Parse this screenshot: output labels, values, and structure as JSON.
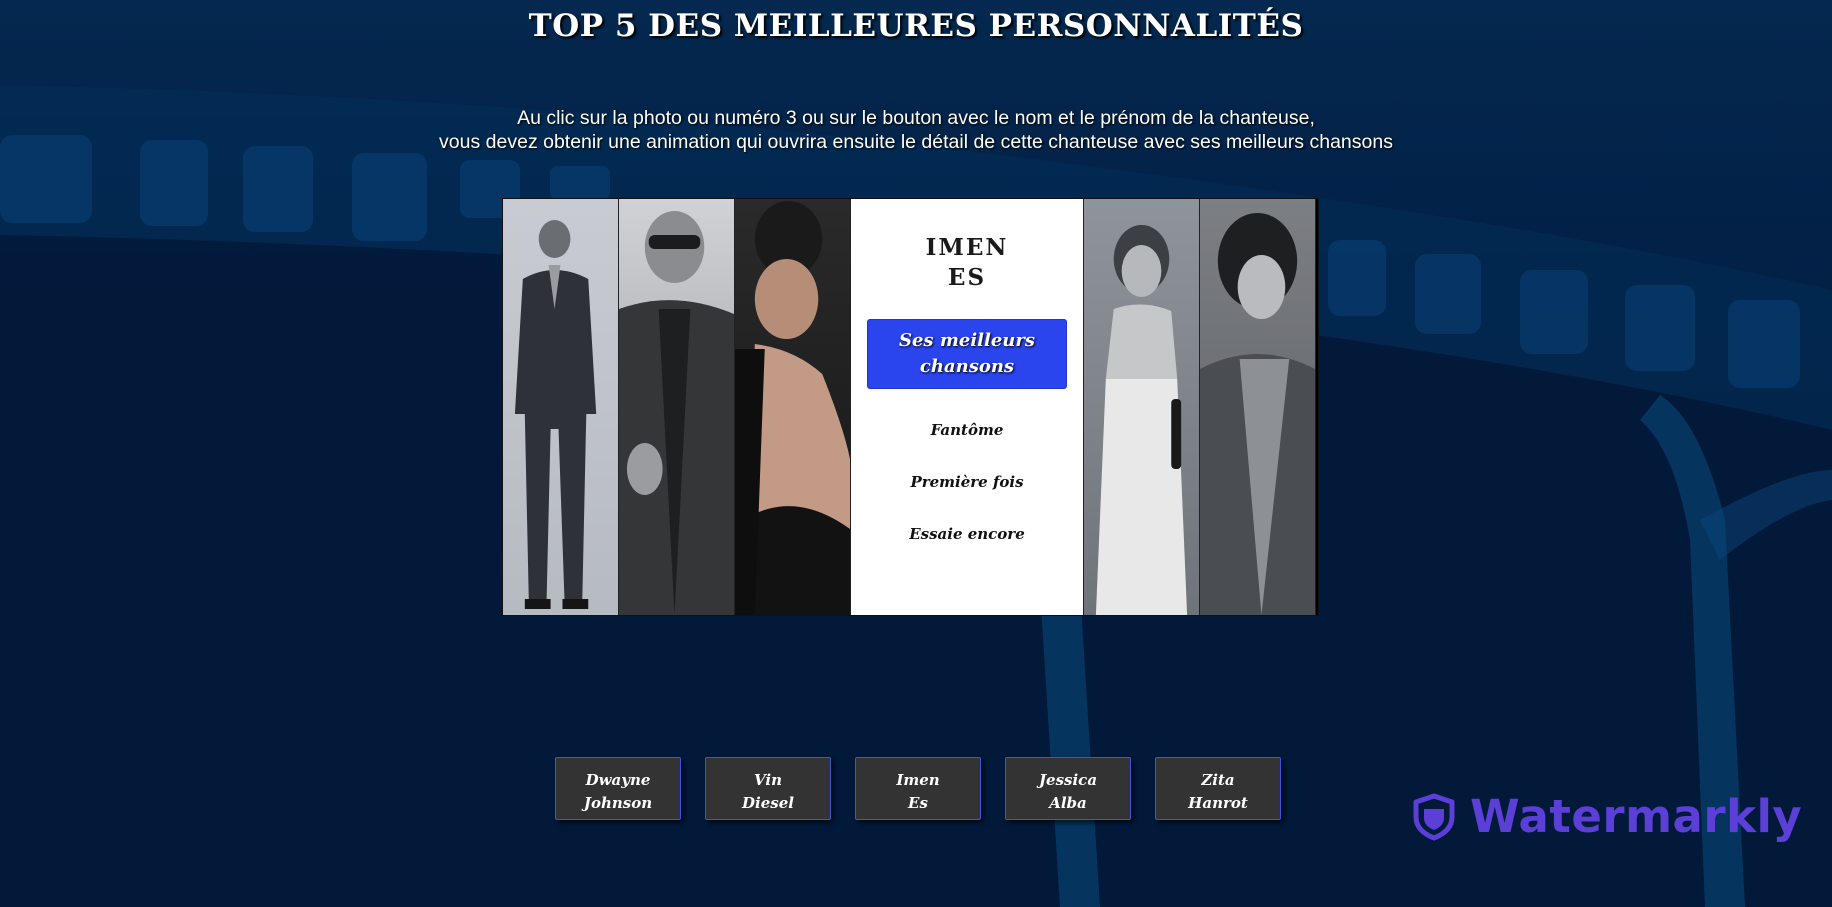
{
  "header": {
    "title": "TOP 5 DES MEILLEURES PERSONNALITÉS",
    "instruction_line1": "Au clic sur la photo ou numéro 3 ou sur le bouton avec le nom et le prénom de la chanteuse,",
    "instruction_line2": "vous devez obtenir une animation qui ouvrira ensuite le détail de cette chanteuse avec ses meilleurs chansons"
  },
  "detail": {
    "first_name": "IMEN",
    "last_name": "ES",
    "songs_button_line1": "Ses meilleurs",
    "songs_button_line2": "chansons",
    "songs": [
      "Fantôme",
      "Première fois",
      "Essaie encore"
    ]
  },
  "name_buttons": [
    {
      "first": "Dwayne",
      "last": "Johnson"
    },
    {
      "first": "Vin",
      "last": "Diesel"
    },
    {
      "first": "Imen",
      "last": "Es"
    },
    {
      "first": "Jessica",
      "last": "Alba"
    },
    {
      "first": "Zita",
      "last": "Hanrot"
    }
  ],
  "watermark": {
    "text": "Watermarkly",
    "icon": "shield-icon",
    "color": "#5b3fd6"
  },
  "colors": {
    "background": "#032147",
    "accent_button": "#2a44ee",
    "name_button_bg": "#333333",
    "name_button_border": "#3a55e0"
  }
}
